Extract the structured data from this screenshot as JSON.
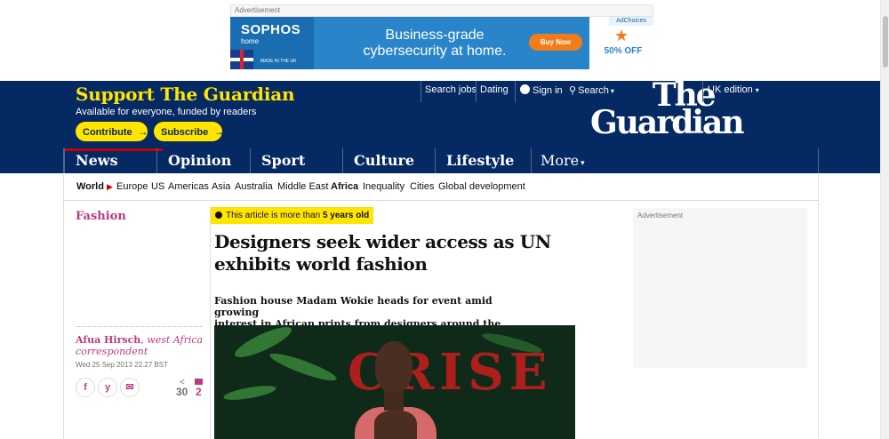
{
  "ad_top": {
    "label": "Advertisement",
    "brand": "SOPHOS",
    "brand_sub": "home",
    "made_in": "MADE IN THE UK",
    "headline_line1": "Business-grade",
    "headline_line2": "cybersecurity at home.",
    "buy_label": "Buy Now",
    "offer": "50% OFF",
    "adchoices": "AdChoices"
  },
  "header": {
    "support_title": "Support The Guardian",
    "support_sub": "Available for everyone, funded by readers",
    "contribute": "Contribute",
    "subscribe": "Subscribe",
    "search_jobs": "Search jobs",
    "dating": "Dating",
    "sign_in": "Sign in",
    "search": "Search",
    "edition": "UK edition",
    "logo_line1": "The",
    "logo_line2": "Guardian"
  },
  "pillars": {
    "news": "News",
    "opinion": "Opinion",
    "sport": "Sport",
    "culture": "Culture",
    "lifestyle": "Lifestyle",
    "more": "More"
  },
  "subnav": {
    "world": "World",
    "items": [
      "Europe",
      "US",
      "Americas",
      "Asia",
      "Australia",
      "Middle East",
      "Africa",
      "Inequality",
      "Cities",
      "Global development"
    ]
  },
  "article": {
    "section": "Fashion",
    "age_prefix": "This article is more than ",
    "age_value": "5 years old",
    "headline_line1": "Designers seek wider access as UN",
    "headline_line2": "exhibits world fashion",
    "standfirst_line1": "Fashion house Madam Wokie heads for event amid growing",
    "standfirst_line2": "interest in African prints from designers around the world",
    "author": "Afua Hirsch",
    "role_line1": "west Africa",
    "role_line2": "correspondent",
    "date": "Wed 25 Sep 2013 22.27 BST",
    "share_count": "30",
    "comment_count": "2",
    "photo_text": "CRISE"
  },
  "right_ad": {
    "label": "Advertisement"
  },
  "colors": {
    "brand_blue": "#052962",
    "yellow": "#ffe500",
    "news_red": "#c70000",
    "lifestyle_pink": "#bb3b80"
  }
}
